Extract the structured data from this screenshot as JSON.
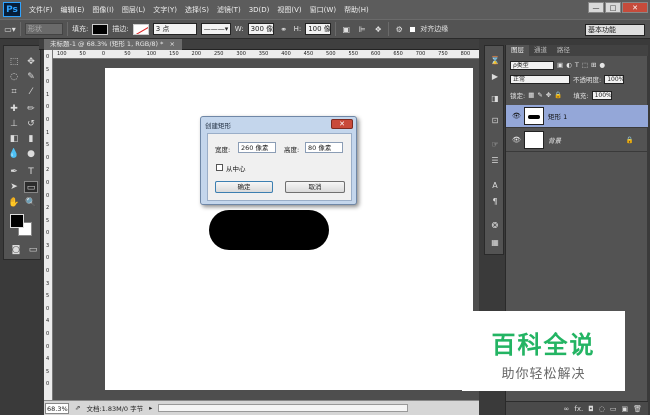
{
  "menubar": {
    "logo": "Ps",
    "items": [
      "文件(F)",
      "编辑(E)",
      "图像(I)",
      "图层(L)",
      "文字(Y)",
      "选择(S)",
      "滤镜(T)",
      "3D(D)",
      "视图(V)",
      "窗口(W)",
      "帮助(H)"
    ],
    "window_buttons": {
      "minimize": "—",
      "maximize": "□",
      "close": "✕"
    }
  },
  "options_bar": {
    "mode": "形状",
    "fill_label": "填充:",
    "stroke_label": "描边:",
    "stroke_size": "3 点",
    "width_label": "W:",
    "width_value": "300 像",
    "height_label": "H:",
    "height_value": "100 像",
    "align_edges_label": "对齐边缘",
    "workspace": "基本功能"
  },
  "document": {
    "tab_title": "未标题-1 @ 68.3% (矩形 1, RGB/8) *",
    "close_glyph": "×",
    "ruler_top": [
      "100",
      "50",
      "0",
      "50",
      "100",
      "150",
      "200",
      "250",
      "300",
      "350",
      "400",
      "450",
      "500",
      "550",
      "600",
      "650",
      "700",
      "750",
      "800"
    ],
    "ruler_left": [
      "0",
      "5",
      "0",
      "1",
      "0",
      "0",
      "1",
      "5",
      "0",
      "2",
      "0",
      "0",
      "2",
      "5",
      "0",
      "3",
      "0",
      "0",
      "3",
      "5",
      "0",
      "4",
      "0",
      "0",
      "4",
      "5",
      "0"
    ]
  },
  "status": {
    "zoom": "68.3%",
    "doc_info": "文档:1.83M/0 字节"
  },
  "dialog": {
    "title": "创建矩形",
    "width_label": "宽度:",
    "width_value": "260 像素",
    "height_label": "高度:",
    "height_value": "80 像素",
    "from_center_label": "从中心",
    "ok_label": "确定",
    "cancel_label": "取消"
  },
  "layers_panel": {
    "tabs": [
      "图层",
      "通道",
      "路径"
    ],
    "filter_kind": "ρ类型",
    "blend_mode": "正常",
    "opacity_label": "不透明度:",
    "opacity_value": "100%",
    "lock_label": "锁定:",
    "fill_label": "填充:",
    "fill_value": "100%",
    "layers": [
      {
        "name": "矩形 1",
        "selected": true
      },
      {
        "name": "背景",
        "selected": false
      }
    ],
    "bottom_icons": [
      "∞",
      "fx.",
      "◘",
      "◌",
      "▭",
      "▣",
      "🗑"
    ]
  },
  "watermark": {
    "line1": "百科全说",
    "line2": "助你轻松解决"
  }
}
